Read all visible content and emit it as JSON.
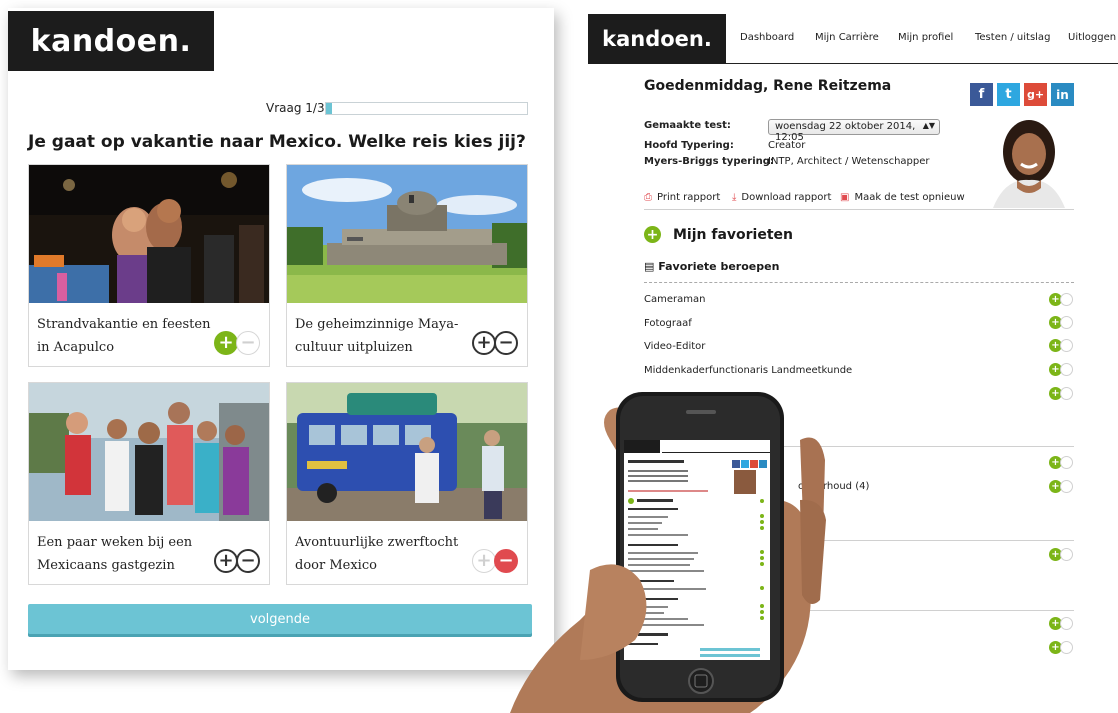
{
  "quiz": {
    "logo": "kandoen.",
    "progress_label": "Vraag 1/32",
    "progress_fraction": 0.03,
    "question": "Je gaat op vakantie naar Mexico. Welke reis kies jij?",
    "cards": [
      {
        "caption": "Strandvakantie en feesten in Acapulco",
        "state": "plus"
      },
      {
        "caption": "De geheimzinnige Maya-cultuur uitpluizen",
        "state": "none"
      },
      {
        "caption": "Een paar weken bij een Mexicaans gastgezin",
        "state": "none"
      },
      {
        "caption": "Avontuurlijke zwerftocht door Mexico",
        "state": "minus"
      }
    ],
    "toggle_plus": "+",
    "toggle_minus": "−",
    "next_label": "volgende"
  },
  "dashboard": {
    "logo": "kandoen.",
    "nav": [
      "Dashboard",
      "Mijn Carrière",
      "Mijn profiel",
      "Testen / uitslag",
      "Uitloggen"
    ],
    "greeting": "Goedenmiddag, Rene Reitzema",
    "social": [
      {
        "label": "f",
        "color": "#3b5998"
      },
      {
        "label": "t",
        "color": "#2ea7e0"
      },
      {
        "label": "g+",
        "color": "#dd4b39"
      },
      {
        "label": "in",
        "color": "#2a8bc2"
      }
    ],
    "test_label": "Gemaakte test:",
    "test_value": "woensdag 22 oktober 2014, 12:05",
    "typing_label": "Hoofd Typering:",
    "typing_value": "Creator",
    "mb_label": "Myers-Briggs typering:",
    "mb_value": "INTP, Architect / Wetenschapper",
    "actions": [
      "Print rapport",
      "Download rapport",
      "Maak de test opnieuw"
    ],
    "favorites_title": "Mijn favorieten",
    "favorite_jobs_title": "Favoriete beroepen",
    "jobs": [
      "Cameraman",
      "Fotograaf",
      "Video-Editor",
      "Middenkaderfunctionaris Landmeetkunde"
    ],
    "partial_texts": [
      "onderhoud (4)",
      "n"
    ]
  }
}
